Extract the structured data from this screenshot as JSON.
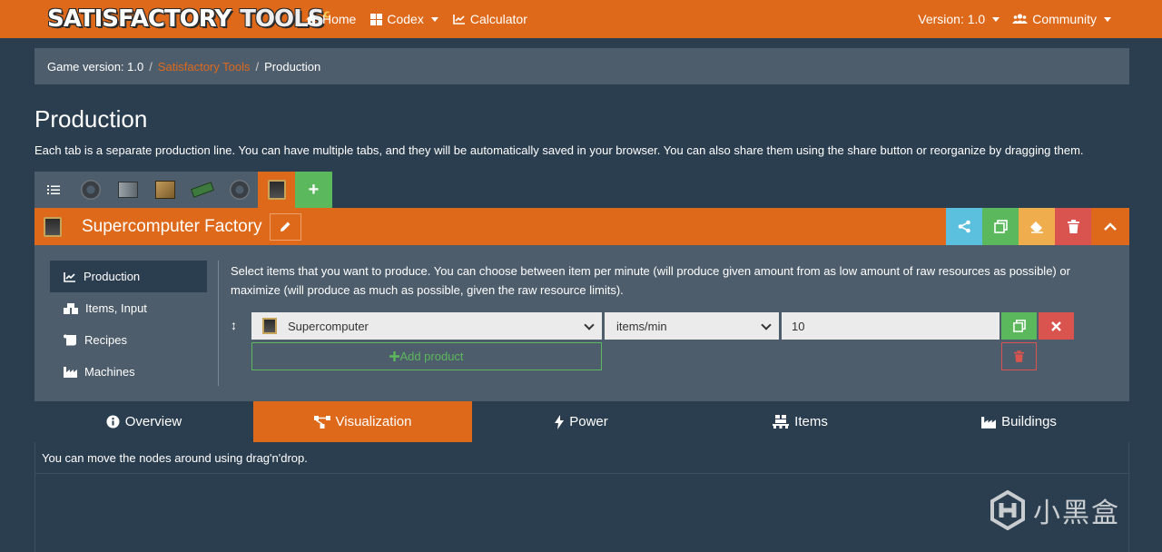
{
  "navbar": {
    "logo_part1": "SATISFACTORY",
    "logo_part2": "TOOLS",
    "home": "Home",
    "codex": "Codex",
    "calculator": "Calculator",
    "version": "Version: 1.0",
    "community": "Community"
  },
  "breadcrumb": {
    "game_version": "Game version: 1.0",
    "site": "Satisfactory Tools",
    "current": "Production",
    "separator": "/"
  },
  "page": {
    "title": "Production",
    "description": "Each tab is a separate production line. You can have multiple tabs, and they will be automatically saved in your browser. You can also share them using the share button or reorganize by dragging them."
  },
  "tabs": {
    "add_label": "+"
  },
  "factory": {
    "name": "Supercomputer Factory"
  },
  "sidebar": {
    "items": [
      {
        "label": "Production",
        "icon": "chart-line-icon"
      },
      {
        "label": "Items, Input",
        "icon": "boxes-icon"
      },
      {
        "label": "Recipes",
        "icon": "scroll-icon"
      },
      {
        "label": "Machines",
        "icon": "industry-icon"
      }
    ]
  },
  "production": {
    "description": "Select items that you want to produce. You can choose between item per minute (will produce given amount from as low amount of raw resources as possible) or maximize (will produce as much as possible, given the raw resource limits).",
    "item": "Supercomputer",
    "unit": "items/min",
    "quantity": "10",
    "add_product": "Add product"
  },
  "result_tabs": [
    {
      "label": "Overview",
      "icon": "info-circle-icon"
    },
    {
      "label": "Visualization",
      "icon": "project-diagram-icon"
    },
    {
      "label": "Power",
      "icon": "bolt-icon"
    },
    {
      "label": "Items",
      "icon": "pallet-icon"
    },
    {
      "label": "Buildings",
      "icon": "industry-icon"
    }
  ],
  "visualization": {
    "hint": "You can move the nodes around using drag'n'drop."
  },
  "watermark": {
    "text": "小黑盒"
  },
  "colors": {
    "accent": "#df691a",
    "background": "#2b3e50",
    "panel": "#4e5d6c",
    "success": "#5cb85c",
    "danger": "#d9534f",
    "info": "#5bc0de",
    "warning": "#f0ad4e"
  }
}
